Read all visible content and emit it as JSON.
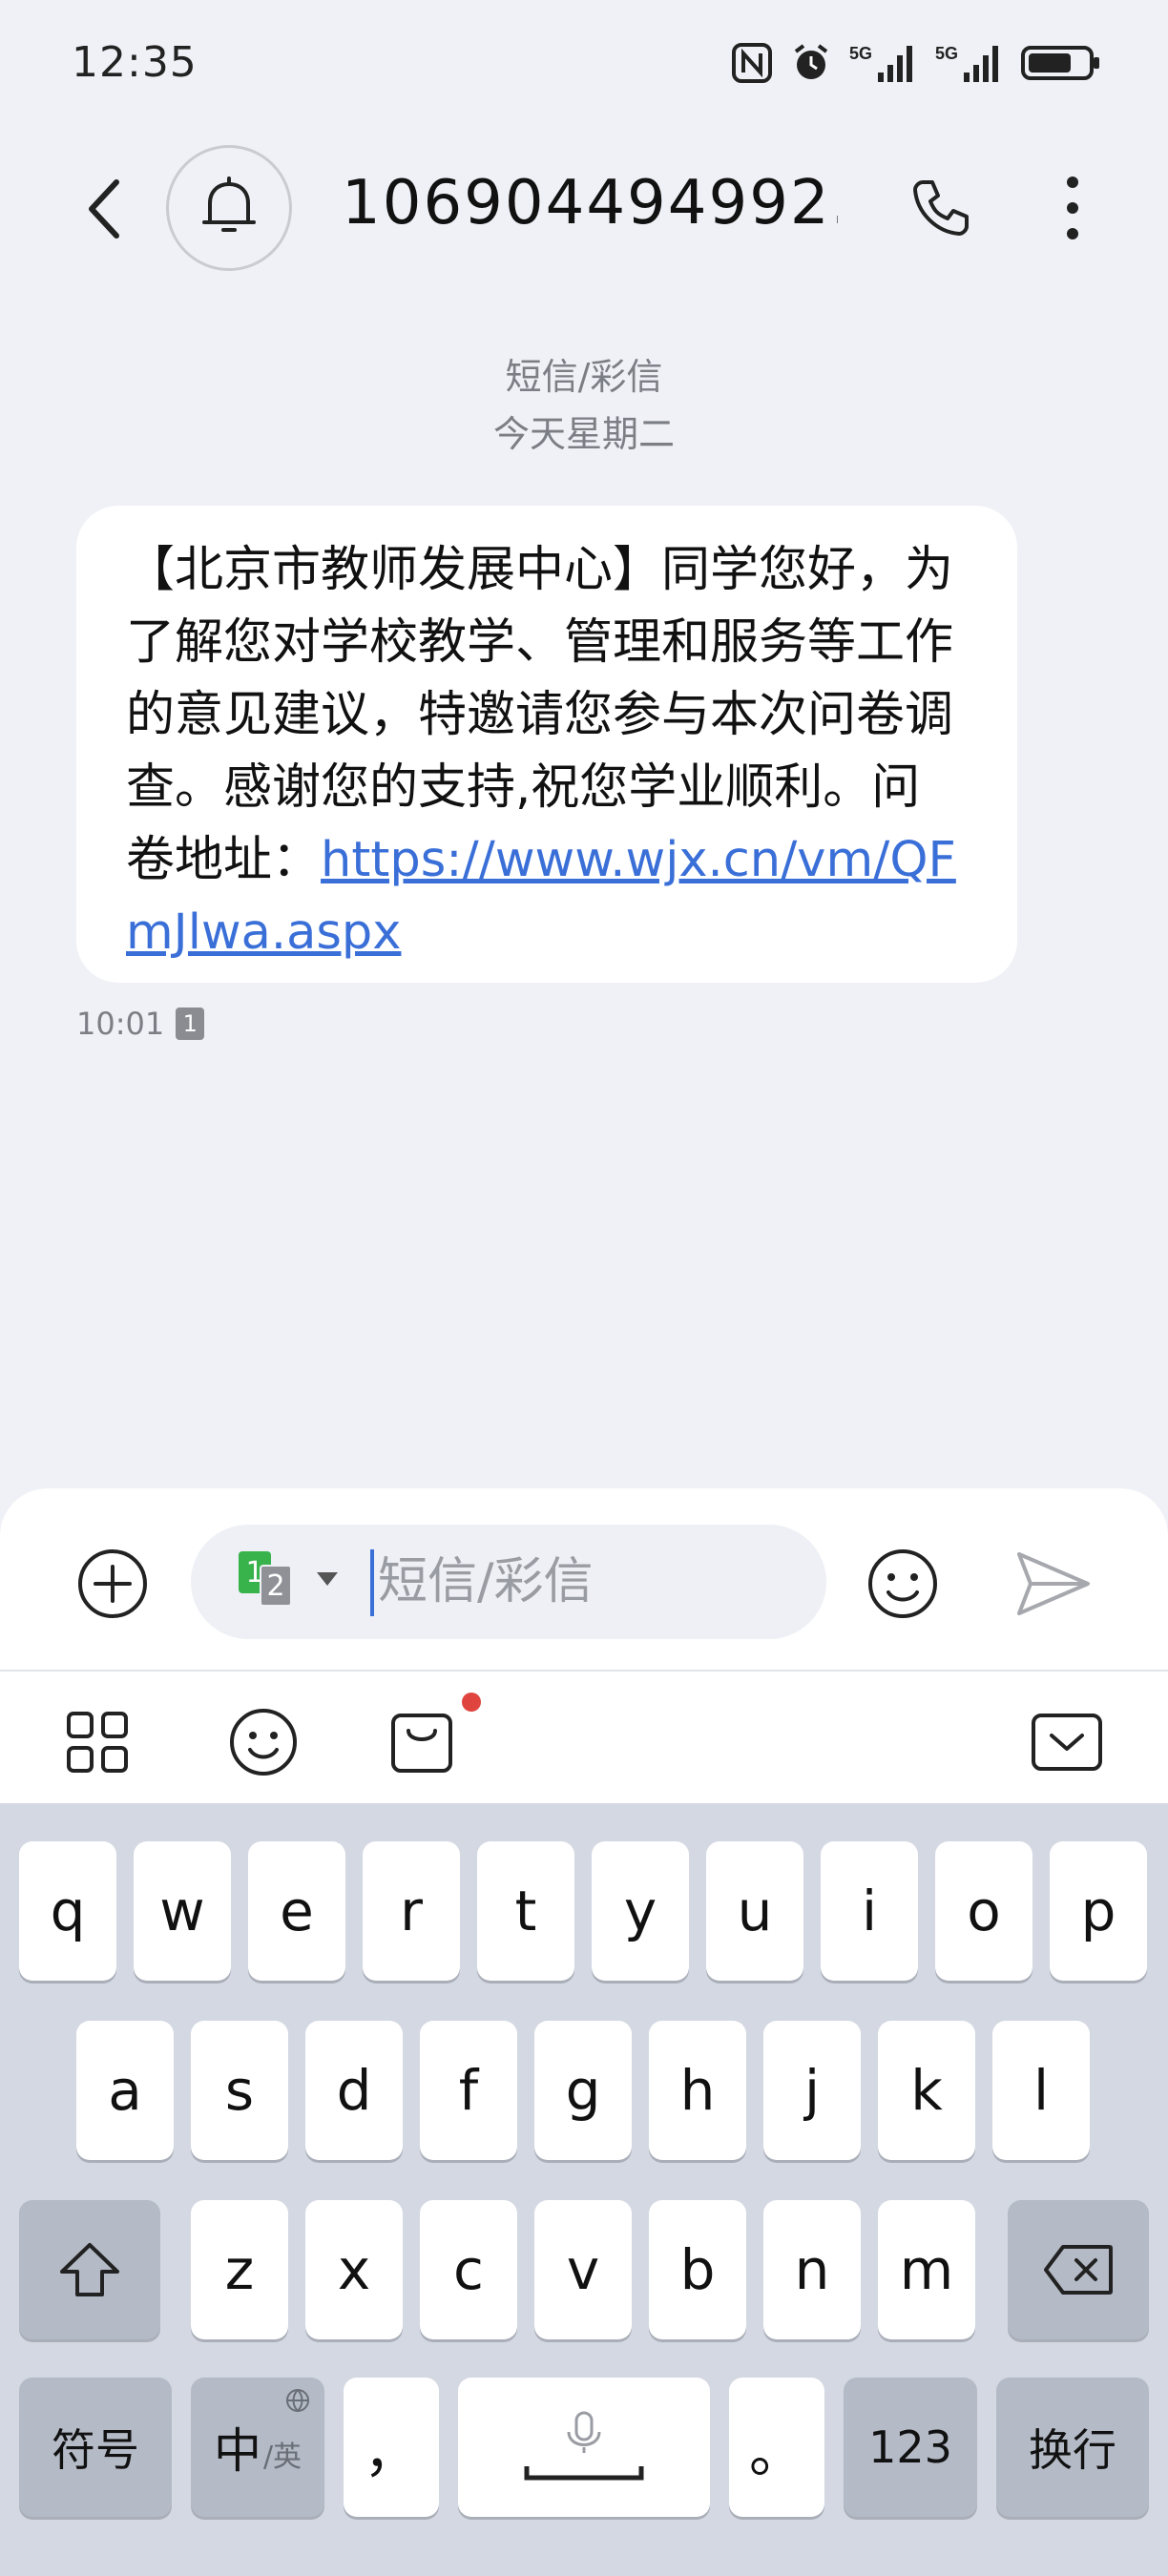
{
  "status_bar": {
    "time": "12:35",
    "icons": [
      "nfc-icon",
      "alarm-icon",
      "5g-signal-icon",
      "5g-signal-icon",
      "battery-icon"
    ]
  },
  "header": {
    "contact": "106904494992...",
    "icons": [
      "back-icon",
      "bell-icon",
      "phone-icon",
      "more-vertical-icon"
    ]
  },
  "conversation": {
    "type_label": "短信/彩信",
    "date_label": "今天星期二",
    "message": {
      "text": "【北京市教师发展中心】同学您好，为了解您对学校教学、管理和服务等工作的意见建议，特邀请您参与本次问卷调查。感谢您的支持,祝您学业顺利。问卷地址：",
      "link": "https://www.wjx.cn/vm/QFmJlwa.aspx",
      "time": "10:01",
      "sim": "1"
    }
  },
  "compose": {
    "placeholder": "短信/彩信",
    "sim_primary": "1",
    "sim_secondary": "2"
  },
  "keyboard": {
    "row1": [
      "q",
      "w",
      "e",
      "r",
      "t",
      "y",
      "u",
      "i",
      "o",
      "p"
    ],
    "row2": [
      "a",
      "s",
      "d",
      "f",
      "g",
      "h",
      "j",
      "k",
      "l"
    ],
    "row3": [
      "z",
      "x",
      "c",
      "v",
      "b",
      "n",
      "m"
    ],
    "symbols_label": "符号",
    "lang_label": "中",
    "lang_sub_label": "/英",
    "comma_label": "，",
    "period_label": "。",
    "numbers_label": "123",
    "enter_label": "换行"
  },
  "colors": {
    "background": "#f0f1f6",
    "link": "#3a6fd8",
    "sim1": "#38b24a",
    "notification_dot": "#e0443e",
    "keyboard_bg": "#d3d8e2"
  }
}
